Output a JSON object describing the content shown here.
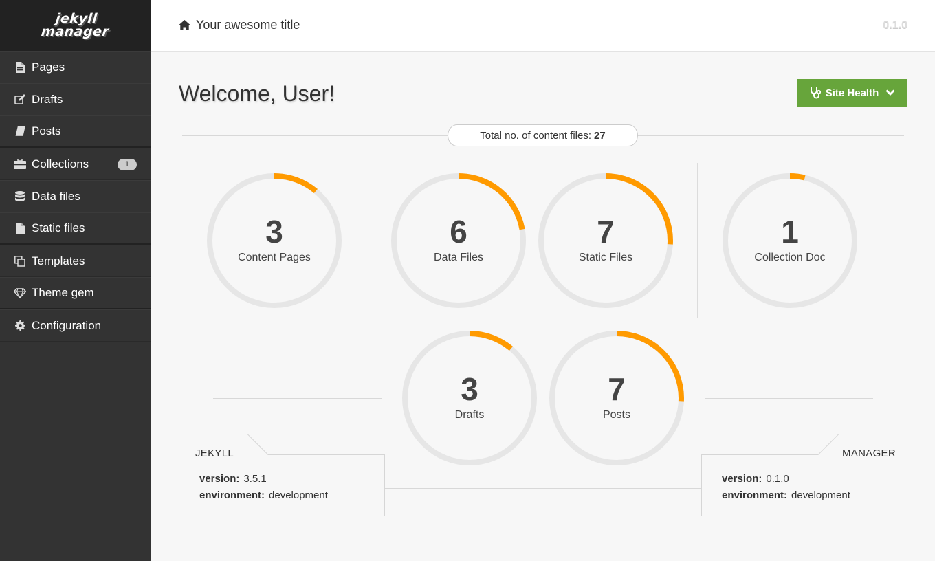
{
  "sidebar": {
    "logo": {
      "line1": "jekyll",
      "line2": "manager"
    },
    "items": [
      {
        "label": "Pages",
        "icon": "file-text-icon"
      },
      {
        "label": "Drafts",
        "icon": "edit-icon"
      },
      {
        "label": "Posts",
        "icon": "book-icon"
      },
      {
        "label": "Collections",
        "icon": "briefcase-icon",
        "badge": "1"
      },
      {
        "label": "Data files",
        "icon": "database-icon"
      },
      {
        "label": "Static files",
        "icon": "file-icon"
      },
      {
        "label": "Templates",
        "icon": "clone-icon"
      },
      {
        "label": "Theme gem",
        "icon": "diamond-icon"
      },
      {
        "label": "Configuration",
        "icon": "gear-icon"
      }
    ]
  },
  "header": {
    "site_title": "Your awesome title",
    "app_version": "0.1.0",
    "icon": "home-icon"
  },
  "main": {
    "welcome": "Welcome, User!",
    "site_health_label": "Site Health",
    "total": {
      "label": "Total no. of content files:",
      "value": "27"
    },
    "stats": [
      {
        "value": "3",
        "label": "Content Pages",
        "progress": 0.111
      },
      {
        "value": "6",
        "label": "Data Files",
        "progress": 0.222
      },
      {
        "value": "7",
        "label": "Static Files",
        "progress": 0.259
      },
      {
        "value": "1",
        "label": "Collection Doc",
        "progress": 0.037
      },
      {
        "value": "3",
        "label": "Drafts",
        "progress": 0.111
      },
      {
        "value": "7",
        "label": "Posts",
        "progress": 0.259
      }
    ],
    "jekyll": {
      "title": "JEKYLL",
      "version_label": "version:",
      "version": "3.5.1",
      "env_label": "environment:",
      "env": "development"
    },
    "manager": {
      "title": "MANAGER",
      "version_label": "version:",
      "version": "0.1.0",
      "env_label": "environment:",
      "env": "development"
    }
  },
  "colors": {
    "accent": "#ff9a00",
    "track": "#e6e6e6",
    "success": "#67a53b",
    "sidebar": "#333333"
  }
}
